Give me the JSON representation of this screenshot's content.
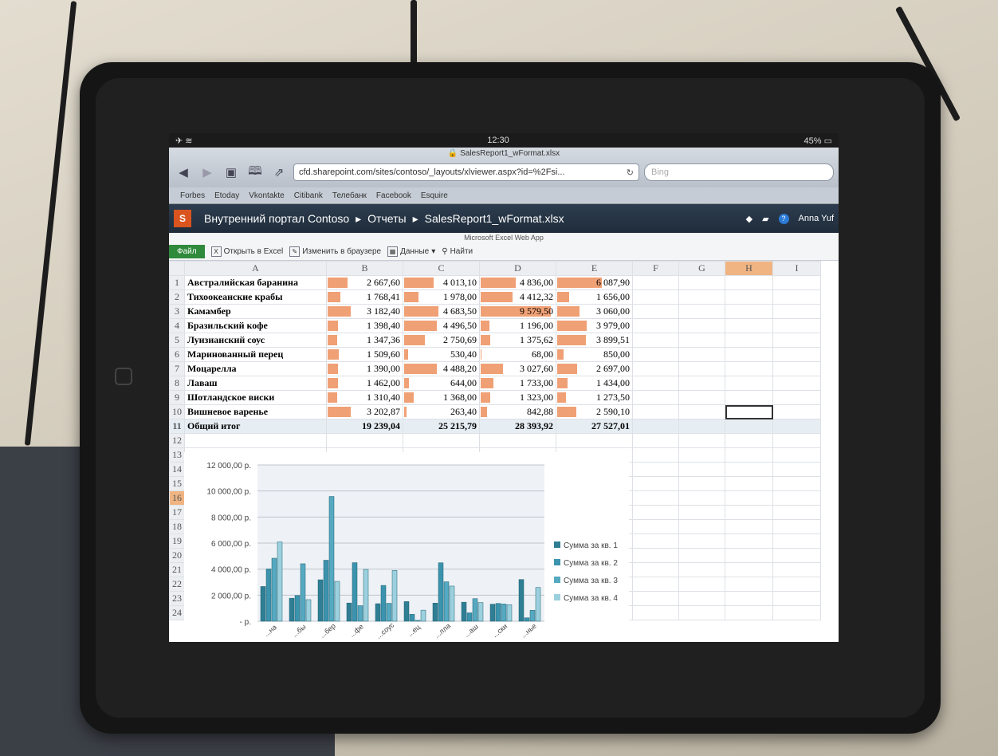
{
  "status": {
    "time": "12:30",
    "battery": "45%"
  },
  "browser": {
    "page_title": "SalesReport1_wFormat.xlsx",
    "url": "cfd.sharepoint.com/sites/contoso/_layouts/xlviewer.aspx?id=%2Fsi...",
    "search_placeholder": "Bing",
    "bookmarks": [
      "Forbes",
      "Etoday",
      "Vkontakte",
      "Citibank",
      "Телебанк",
      "Facebook",
      "Esquire"
    ]
  },
  "sharepoint": {
    "logo": "S",
    "crumbs": [
      "Внутренний портал Contoso",
      "Отчеты",
      "SalesReport1_wFormat.xlsx"
    ],
    "user": "Anna Yuf"
  },
  "ewa": {
    "app_title": "Microsoft Excel Web App",
    "file_tab": "Файл",
    "open_excel": "Открыть в Excel",
    "edit_browser": "Изменить в браузере",
    "data": "Данные",
    "find": "Найти"
  },
  "sheet": {
    "columns": [
      "A",
      "B",
      "C",
      "D",
      "E",
      "F",
      "G",
      "H",
      "I"
    ],
    "selected_column": "H",
    "selected_row": 16,
    "rows": [
      {
        "n": "1",
        "name": "Австралийская баранина",
        "vals": [
          "2 667,60",
          "4 013,10",
          "4 836,00",
          "6 087,90"
        ],
        "bars": [
          0.28,
          0.42,
          0.5,
          0.64
        ]
      },
      {
        "n": "2",
        "name": "Тихоокеанские крабы",
        "vals": [
          "1 768,41",
          "1 978,00",
          "4 412,32",
          "1 656,00"
        ],
        "bars": [
          0.18,
          0.21,
          0.46,
          0.17
        ]
      },
      {
        "n": "3",
        "name": "Камамбер",
        "vals": [
          "3 182,40",
          "4 683,50",
          "9 579,50",
          "3 060,00"
        ],
        "bars": [
          0.33,
          0.49,
          1.0,
          0.32
        ]
      },
      {
        "n": "4",
        "name": "Бразильский кофе",
        "vals": [
          "1 398,40",
          "4 496,50",
          "1 196,00",
          "3 979,00"
        ],
        "bars": [
          0.15,
          0.47,
          0.12,
          0.42
        ]
      },
      {
        "n": "5",
        "name": "Луизианский соус",
        "vals": [
          "1 347,36",
          "2 750,69",
          "1 375,62",
          "3 899,51"
        ],
        "bars": [
          0.14,
          0.29,
          0.14,
          0.41
        ]
      },
      {
        "n": "6",
        "name": "Маринованный перец",
        "vals": [
          "1 509,60",
          "530,40",
          "68,00",
          "850,00"
        ],
        "bars": [
          0.16,
          0.06,
          0.01,
          0.09
        ]
      },
      {
        "n": "7",
        "name": "Моцарелла",
        "vals": [
          "1 390,00",
          "4 488,20",
          "3 027,60",
          "2 697,00"
        ],
        "bars": [
          0.15,
          0.47,
          0.32,
          0.28
        ]
      },
      {
        "n": "8",
        "name": "Лаваш",
        "vals": [
          "1 462,00",
          "644,00",
          "1 733,00",
          "1 434,00"
        ],
        "bars": [
          0.15,
          0.07,
          0.18,
          0.15
        ]
      },
      {
        "n": "9",
        "name": "Шотландское виски",
        "vals": [
          "1 310,40",
          "1 368,00",
          "1 323,00",
          "1 273,50"
        ],
        "bars": [
          0.14,
          0.14,
          0.14,
          0.13
        ]
      },
      {
        "n": "10",
        "name": "Вишневое варенье",
        "vals": [
          "3 202,87",
          "263,40",
          "842,88",
          "2 590,10"
        ],
        "bars": [
          0.33,
          0.03,
          0.09,
          0.27
        ]
      }
    ],
    "total": {
      "n": "11",
      "name": "Общий итог",
      "vals": [
        "19 239,04",
        "25 215,79",
        "28 393,92",
        "27 527,01"
      ]
    },
    "empty_rows": [
      "12",
      "13",
      "14",
      "15",
      "16",
      "17",
      "18",
      "19",
      "20",
      "21",
      "22",
      "23",
      "24"
    ]
  },
  "chart_data": {
    "type": "bar",
    "categories": [
      "...на",
      "...бы",
      "...бер",
      "...фе",
      "...соус",
      "...ец",
      "...лла",
      "...аш",
      "...ски",
      "...нье"
    ],
    "series": [
      {
        "name": "Сумма за кв. 1",
        "values": [
          2667.6,
          1768.41,
          3182.4,
          1398.4,
          1347.36,
          1509.6,
          1390,
          1462,
          1310.4,
          3202.87
        ],
        "color": "#2f7e94"
      },
      {
        "name": "Сумма за кв. 2",
        "values": [
          4013.1,
          1978,
          4683.5,
          4496.5,
          2750.69,
          530.4,
          4488.2,
          644,
          1368,
          263.4
        ],
        "color": "#3b93ad"
      },
      {
        "name": "Сумма за кв. 3",
        "values": [
          4836,
          4412.32,
          9579.5,
          1196,
          1375.62,
          68,
          3027.6,
          1733,
          1323,
          842.88
        ],
        "color": "#55a9c1"
      },
      {
        "name": "Сумма за кв. 4",
        "values": [
          6087.9,
          1656,
          3060,
          3979,
          3899.51,
          850,
          2697,
          1434,
          1273.5,
          2590.1
        ],
        "color": "#9cd0de"
      }
    ],
    "yticks": [
      "12 000,00 р.",
      "10 000,00 р.",
      "8 000,00 р.",
      "6 000,00 р.",
      "4 000,00 р.",
      "2 000,00 р.",
      "- р."
    ],
    "ylim": [
      0,
      12000
    ],
    "legend": "right"
  }
}
